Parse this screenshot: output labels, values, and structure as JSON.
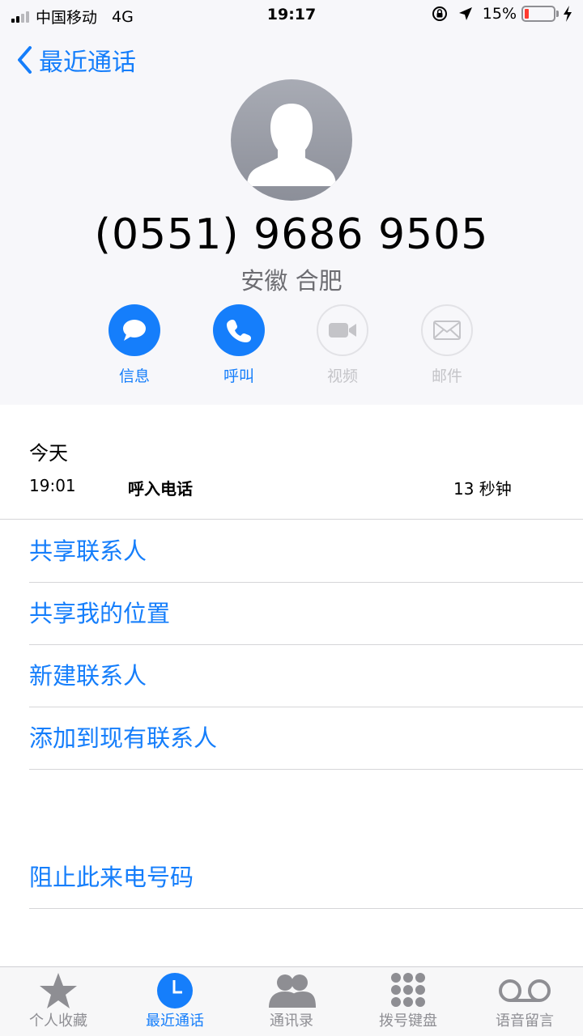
{
  "status_bar": {
    "carrier": "中国移动",
    "network": "4G",
    "time": "19:17",
    "battery_percent": "15%",
    "battery_level": 0.15
  },
  "header": {
    "back_label": "最近通话",
    "phone_number": "(0551) 9686 9505",
    "location": "安徽 合肥"
  },
  "actions": [
    {
      "label": "信息",
      "icon": "message-icon",
      "enabled": true
    },
    {
      "label": "呼叫",
      "icon": "phone-icon",
      "enabled": true
    },
    {
      "label": "视频",
      "icon": "video-icon",
      "enabled": false
    },
    {
      "label": "邮件",
      "icon": "mail-icon",
      "enabled": false
    }
  ],
  "call_log": {
    "date": "今天",
    "entries": [
      {
        "time": "19:01",
        "type": "呼入电话",
        "duration": "13 秒钟"
      }
    ]
  },
  "options": [
    "共享联系人",
    "共享我的位置",
    "新建联系人",
    "添加到现有联系人",
    "阻止此来电号码"
  ],
  "tab_bar": {
    "tabs": [
      {
        "label": "个人收藏",
        "icon": "star-icon"
      },
      {
        "label": "最近通话",
        "icon": "clock-icon",
        "active": true
      },
      {
        "label": "通讯录",
        "icon": "contacts-icon"
      },
      {
        "label": "拨号键盘",
        "icon": "keypad-icon"
      },
      {
        "label": "语音留言",
        "icon": "voicemail-icon"
      }
    ]
  },
  "colors": {
    "accent": "#157efb",
    "header_bg": "#f7f7fa",
    "battery_low": "#ff3b30"
  }
}
